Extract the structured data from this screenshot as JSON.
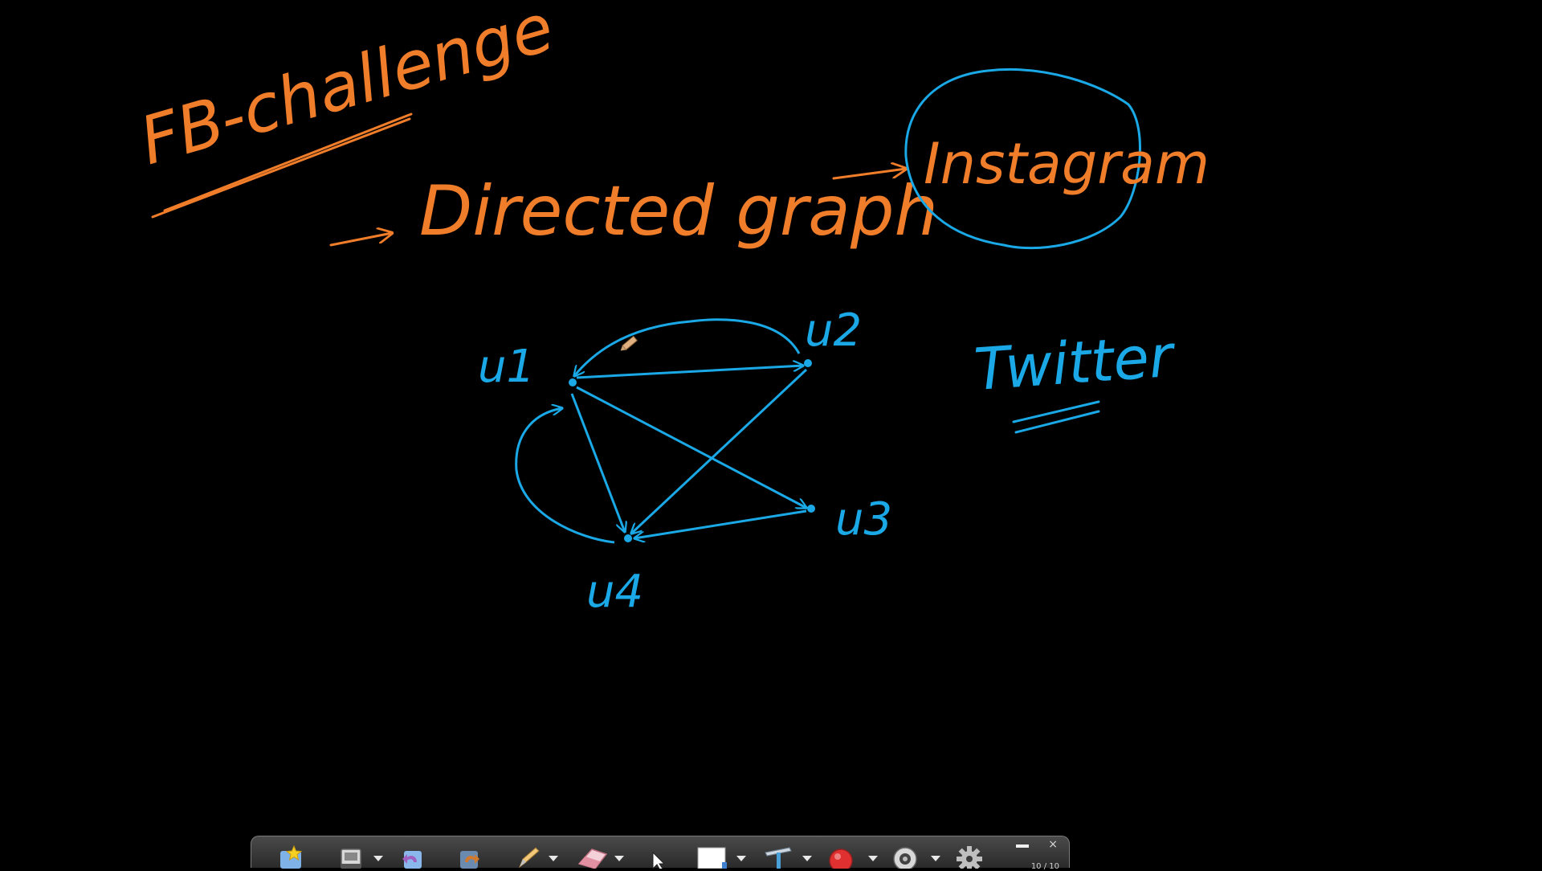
{
  "board": {
    "title": "FB-challenge",
    "line1": "Directed graph",
    "circled": "Instagram",
    "side_note": "Twitter",
    "nodes": {
      "u1": "u1",
      "u2": "u2",
      "u3": "u3",
      "u4": "u4"
    }
  },
  "colors": {
    "ink_orange": "#f07d2a",
    "ink_blue": "#1aa9e6",
    "background": "#000000"
  },
  "toolbar": {
    "tools": [
      "favorites-star-icon",
      "screen-capture-icon",
      "undo-icon",
      "redo-icon",
      "pen-icon",
      "eraser-icon",
      "pointer-icon",
      "page-icon",
      "ruler-tool-icon",
      "record-icon",
      "webcam-icon",
      "settings-gear-icon"
    ],
    "minimize": "minimize",
    "close": "×",
    "page_indicator": "10 / 10"
  }
}
